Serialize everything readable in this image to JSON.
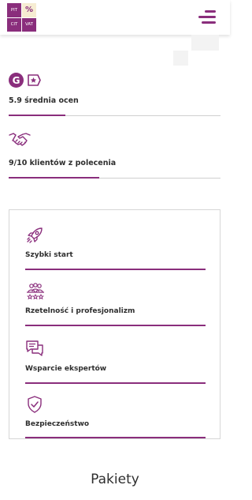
{
  "header": {
    "logo": {
      "tl": "PIT",
      "tr": "%",
      "bl": "CIT",
      "br": "VAT"
    }
  },
  "stats": [
    {
      "label": "5.9 średnia ocen",
      "badge_letter": "G"
    },
    {
      "label": "9/10 klientów z polecenia"
    }
  ],
  "features": [
    {
      "icon": "rocket-icon",
      "label": "Szybki start"
    },
    {
      "icon": "team-icon",
      "label": "Rzetelność i profesjonalizm"
    },
    {
      "icon": "chat-icon",
      "label": "Wsparcie ekspertów"
    },
    {
      "icon": "shield-check-icon",
      "label": "Bezpieczeństwo"
    }
  ],
  "section": {
    "title": "Pakiety"
  },
  "colors": {
    "accent": "#8a2e7c",
    "logo_light": "#f6ecd2",
    "divider": "#cfcfcf"
  }
}
